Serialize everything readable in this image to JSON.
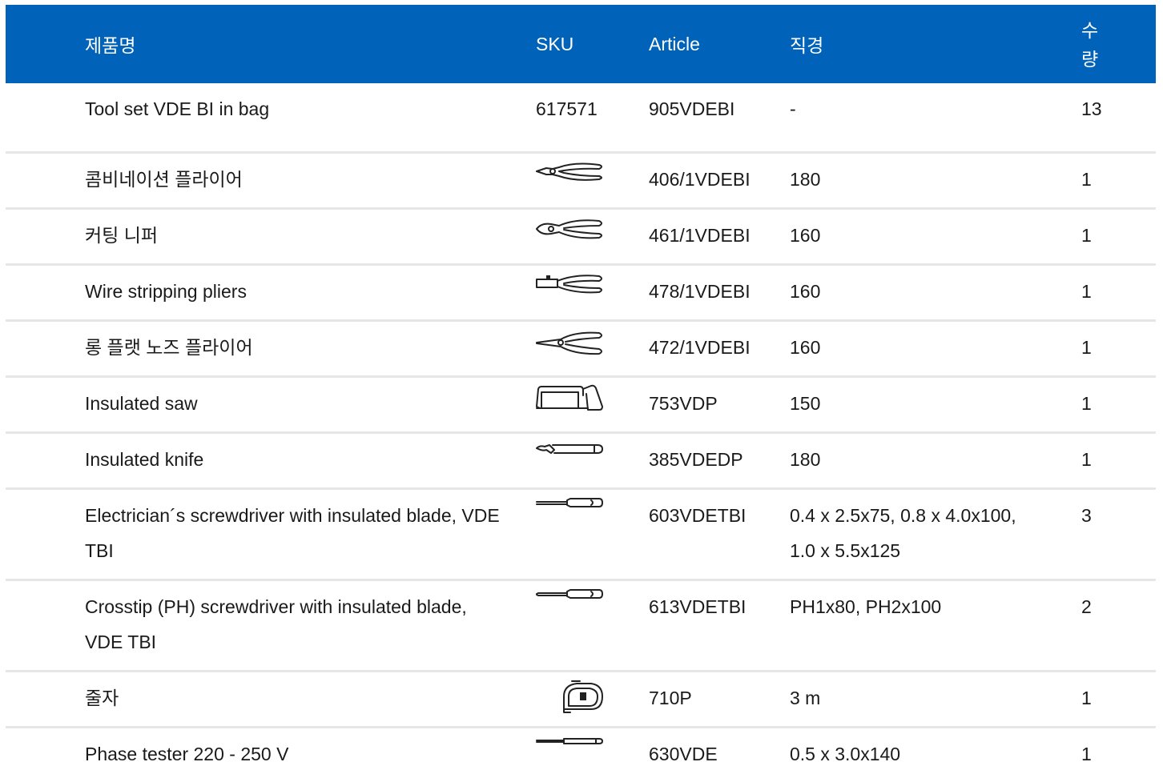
{
  "colors": {
    "header_bg": "#0062b8",
    "header_text": "#ffffff",
    "divider": "#e6e6e6"
  },
  "header": {
    "name": "제품명",
    "sku": "SKU",
    "article": "Article",
    "diameter": "직경",
    "qty_line1": "수",
    "qty_line2": "량"
  },
  "rows": [
    {
      "name": "Tool set VDE BI in bag",
      "sku": "617571",
      "icon": null,
      "article": "905VDEBI",
      "diameter": "-",
      "qty": "13"
    },
    {
      "name": "콤비네이션 플라이어",
      "sku": "",
      "icon": "combination-pliers-icon",
      "article": "406/1VDEBI",
      "diameter": "180",
      "qty": "1"
    },
    {
      "name": "커팅 니퍼",
      "sku": "",
      "icon": "cutting-nipper-icon",
      "article": "461/1VDEBI",
      "diameter": "160",
      "qty": "1"
    },
    {
      "name": "Wire stripping pliers",
      "sku": "",
      "icon": "wire-stripping-pliers-icon",
      "article": "478/1VDEBI",
      "diameter": "160",
      "qty": "1"
    },
    {
      "name": "롱 플랫 노즈 플라이어",
      "sku": "",
      "icon": "long-flat-nose-pliers-icon",
      "article": "472/1VDEBI",
      "diameter": "160",
      "qty": "1"
    },
    {
      "name": "Insulated saw",
      "sku": "",
      "icon": "hacksaw-icon",
      "article": "753VDP",
      "diameter": "150",
      "qty": "1"
    },
    {
      "name": "Insulated knife",
      "sku": "",
      "icon": "knife-icon",
      "article": "385VDEDP",
      "diameter": "180",
      "qty": "1"
    },
    {
      "name": "Electrician´s screwdriver with insulated blade, VDE TBI",
      "sku": "",
      "icon": "flat-screwdriver-icon",
      "article": "603VDETBI",
      "diameter": "0.4 x 2.5x75, 0.8 x 4.0x100, 1.0 x 5.5x125",
      "qty": "3"
    },
    {
      "name": "Crosstip (PH) screwdriver with insulated blade, VDE TBI",
      "sku": "",
      "icon": "phillips-screwdriver-icon",
      "article": "613VDETBI",
      "diameter": "PH1x80, PH2x100",
      "qty": "2"
    },
    {
      "name": "줄자",
      "sku": "",
      "icon": "tape-measure-icon",
      "article": "710P",
      "diameter": "3 m",
      "qty": "1"
    },
    {
      "name": "Phase tester 220 - 250 V",
      "sku": "",
      "icon": "phase-tester-icon",
      "article": "630VDE",
      "diameter": "0.5 x 3.0x140",
      "qty": "1"
    }
  ]
}
